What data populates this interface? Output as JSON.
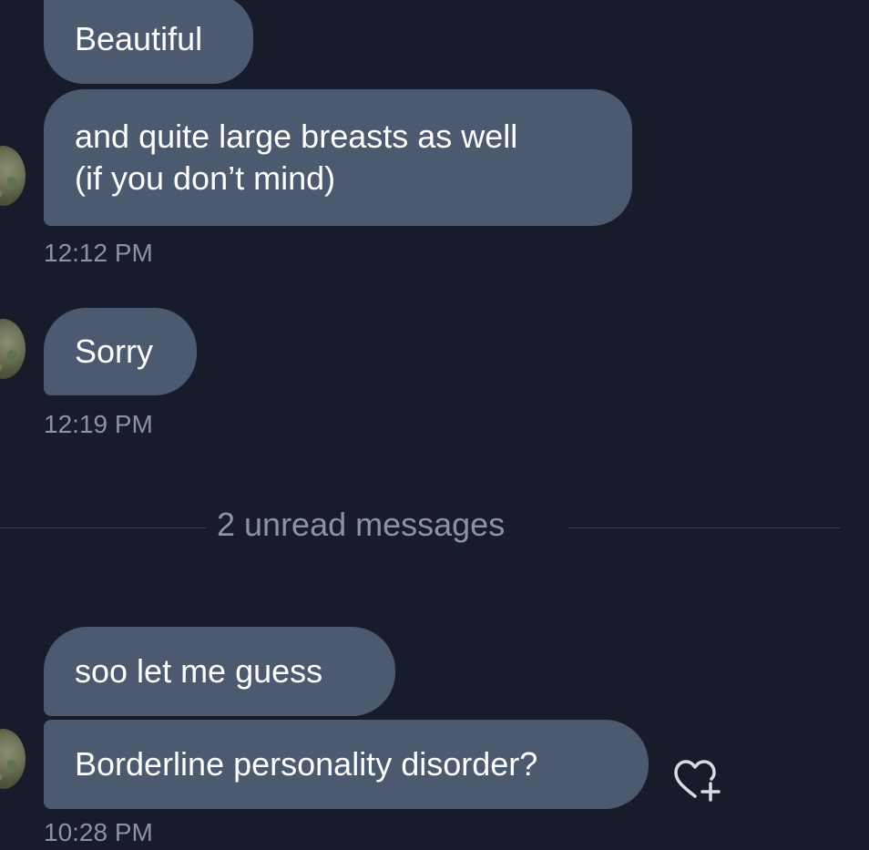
{
  "messages": [
    {
      "text": "Beautiful"
    },
    {
      "lines": [
        "and quite large breasts as well",
        "(if you don’t mind)"
      ]
    },
    {
      "text": "Sorry"
    },
    {
      "text": "soo let me guess"
    },
    {
      "text": "Borderline personality disorder?"
    }
  ],
  "timestamps": [
    "12:12 PM",
    "12:19 PM",
    "10:28 PM"
  ],
  "divider": {
    "label": "2 unread messages"
  },
  "icons": {
    "avatar": "user-avatar",
    "reaction": "heart-add-icon"
  },
  "colors": {
    "background": "#171b2a",
    "bubble": "#4c5a6f",
    "timestamp": "#8a93a3"
  }
}
